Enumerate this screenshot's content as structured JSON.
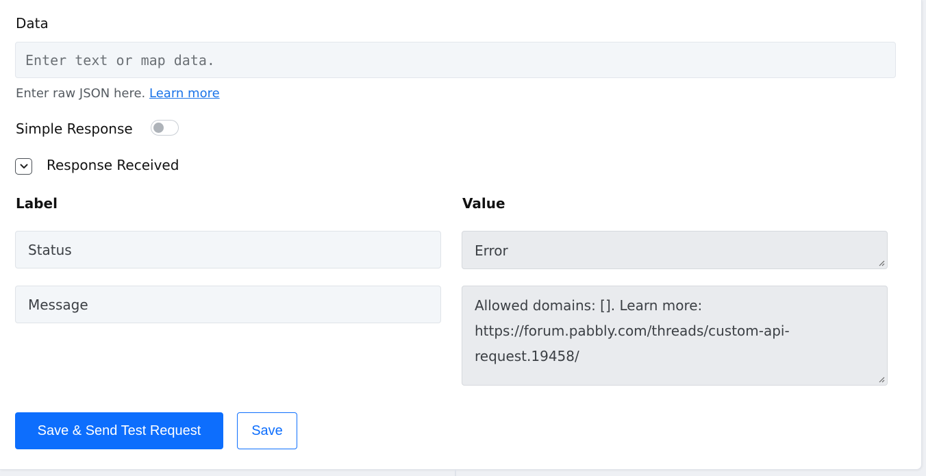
{
  "data_section": {
    "label": "Data",
    "placeholder": "Enter text or map data.",
    "value": "",
    "helper_text": "Enter raw JSON here.",
    "helper_link": "Learn more"
  },
  "simple_response": {
    "label": "Simple Response",
    "enabled": false
  },
  "response_received": {
    "label": "Response Received",
    "icon": "chevron-down-icon",
    "expanded": true
  },
  "table": {
    "label_header": "Label",
    "value_header": "Value",
    "rows": [
      {
        "label": "Status",
        "value": "Error"
      },
      {
        "label": "Message",
        "value": "Allowed domains: []. Learn more: https://forum.pabbly.com/threads/custom-api-request.19458/"
      }
    ]
  },
  "buttons": {
    "send_label": "Save & Send Test Request",
    "save_label": "Save"
  },
  "colors": {
    "accent": "#0d6efd",
    "link": "#1a73e8",
    "input_bg": "#f3f6f9",
    "value_bg": "#e9ebee"
  }
}
